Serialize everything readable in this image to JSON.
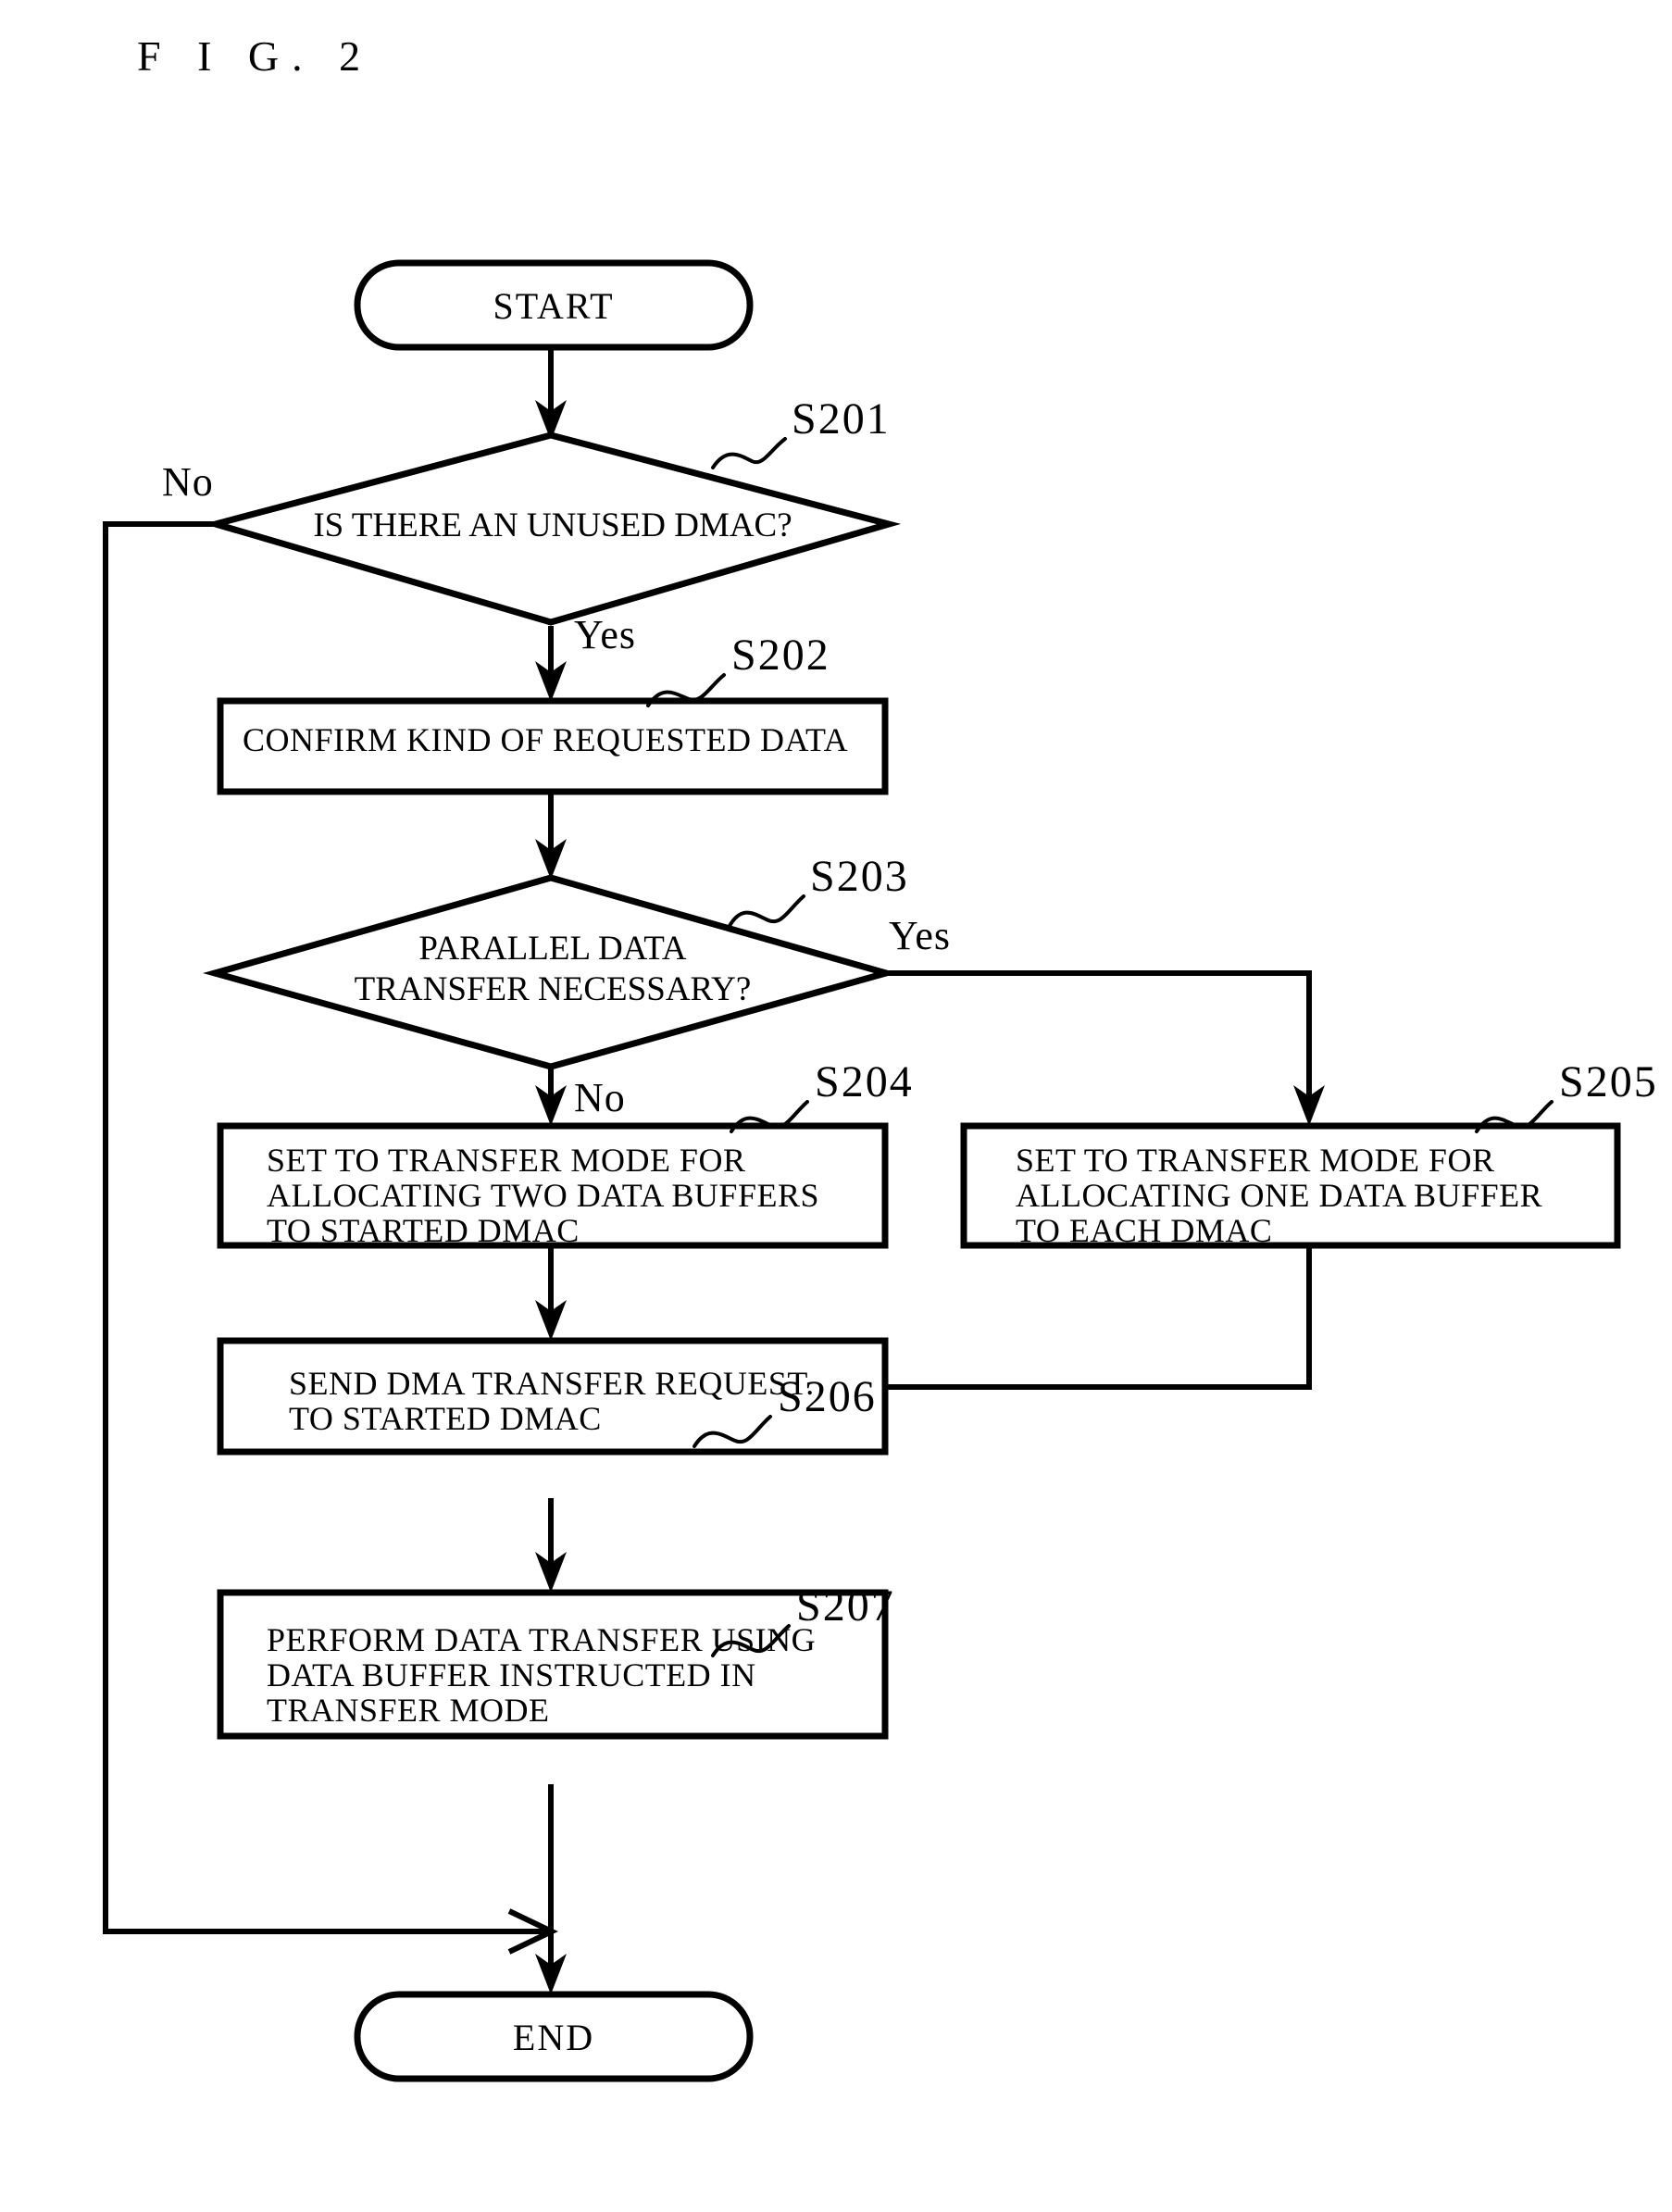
{
  "figure": {
    "title": "F I G. 2"
  },
  "flowchart": {
    "start": {
      "label": "START"
    },
    "end": {
      "label": "END"
    },
    "steps": [
      {
        "tag": "S201",
        "type": "decision",
        "lines": [
          "IS THERE AN UNUSED DMAC?"
        ]
      },
      {
        "tag": "S202",
        "type": "process",
        "lines": [
          "CONFIRM KIND OF REQUESTED DATA"
        ]
      },
      {
        "tag": "S203",
        "type": "decision",
        "lines": [
          "PARALLEL DATA",
          "TRANSFER NECESSARY?"
        ]
      },
      {
        "tag": "S204",
        "type": "process",
        "lines": [
          "SET TO TRANSFER MODE FOR",
          "ALLOCATING TWO DATA BUFFERS",
          "TO STARTED DMAC"
        ]
      },
      {
        "tag": "S205",
        "type": "process",
        "lines": [
          "SET TO TRANSFER MODE FOR",
          "ALLOCATING ONE DATA BUFFER",
          "TO EACH DMAC"
        ]
      },
      {
        "tag": "S206",
        "type": "process",
        "lines": [
          "SEND DMA TRANSFER REQUEST.",
          "TO STARTED DMAC"
        ]
      },
      {
        "tag": "S207",
        "type": "process",
        "lines": [
          "PERFORM DATA TRANSFER USING",
          "DATA BUFFER INSTRUCTED IN",
          "TRANSFER MODE"
        ]
      }
    ],
    "branch_labels": {
      "s201_no": "No",
      "s201_yes": "Yes",
      "s203_yes": "Yes",
      "s203_no": "No"
    }
  },
  "colors": {
    "ink": "#000000",
    "paper": "#ffffff"
  }
}
